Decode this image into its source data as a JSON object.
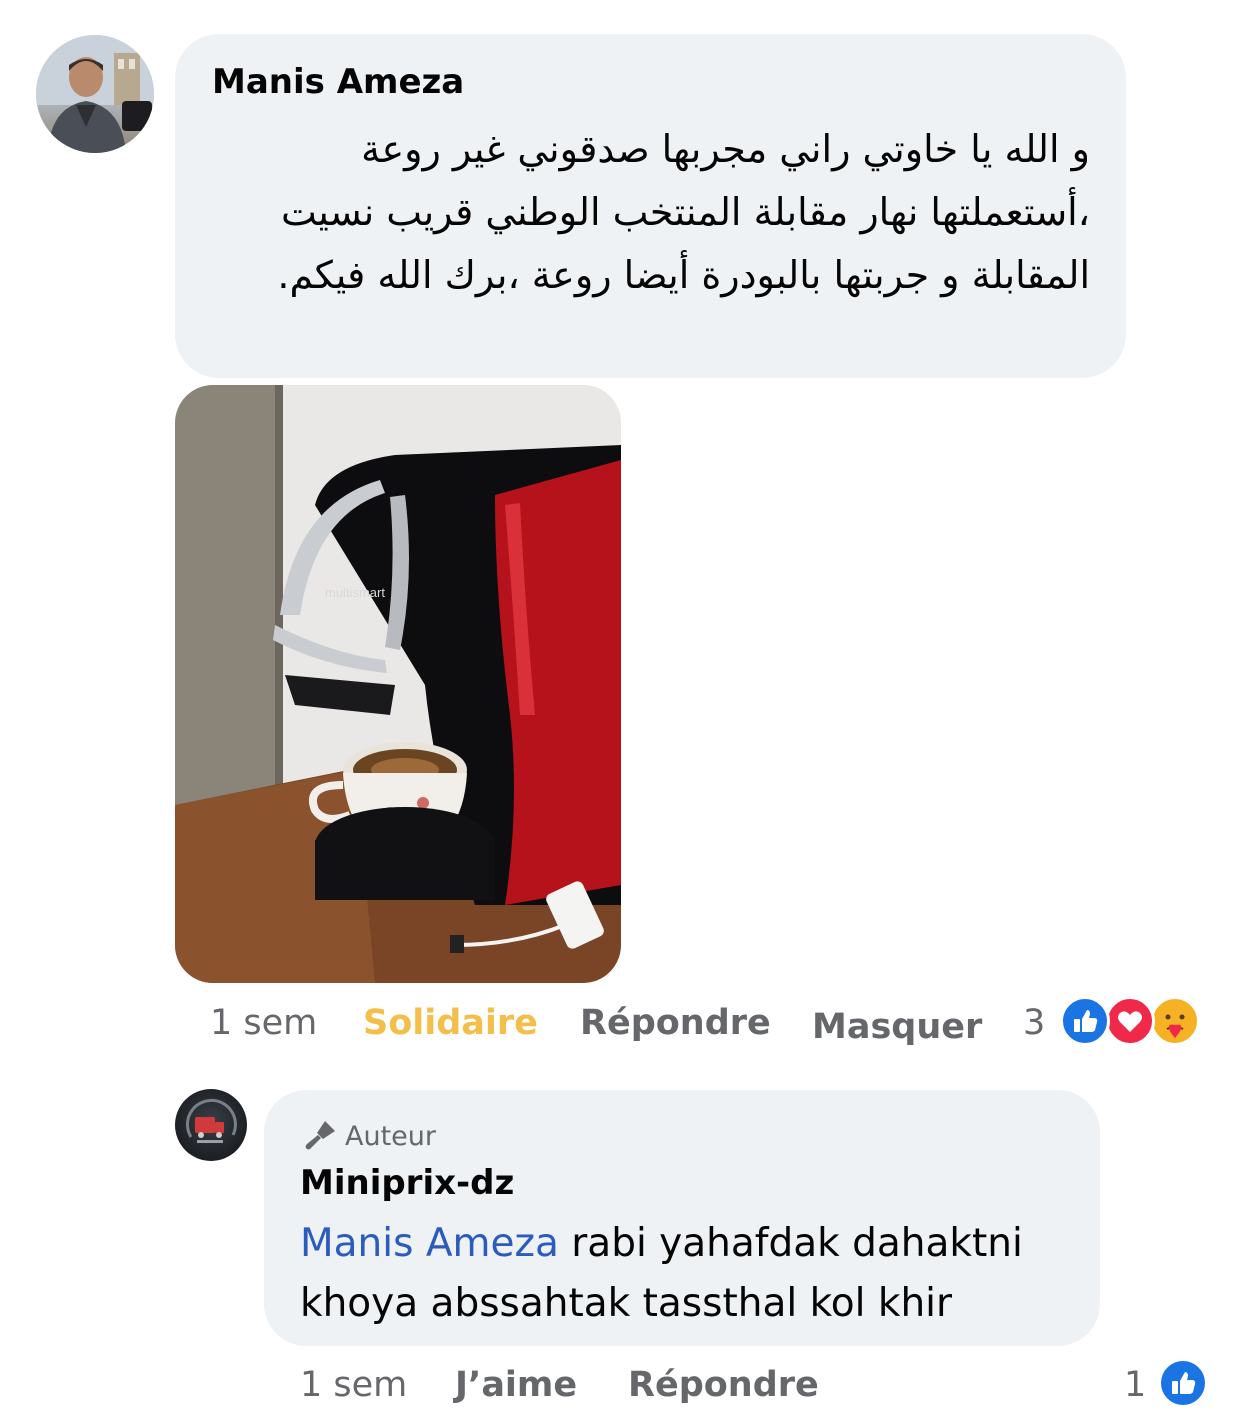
{
  "comment": {
    "author": "Manis Ameza",
    "text": "و الله يا خاوتي راني مجربها صدقوني غير روعة ،أستعملتها نهار مقابلة المنتخب الوطني قريب نسيت المقابلة و جربتها بالبودرة أيضا روعة ،برك الله فيكم.",
    "photo_brand_text": "multismart",
    "time": "1 sem",
    "actions": {
      "solidaire": "Solidaire",
      "reply": "Répondre",
      "hide": "Masquer"
    },
    "reaction_count": "3",
    "reaction_icons": [
      "like-icon",
      "love-icon",
      "care-icon"
    ]
  },
  "reply": {
    "badge": "Auteur",
    "author": "Miniprix-dz",
    "mention": "Manis Ameza",
    "text": " rabi yahafdak  dahaktni khoya abssahtak tassthal kol khir",
    "time": "1 sem",
    "actions": {
      "like": "J’aime",
      "reply": "Répondre"
    },
    "reaction_count": "1",
    "reaction_icons": [
      "like-icon"
    ]
  },
  "colors": {
    "bubble": "#eff2f5",
    "solidaire": "#f4be4a",
    "secondary_text": "#65676b",
    "mention": "#2b5bbd",
    "like": "#1b74e4",
    "love": "#f02849",
    "care": "#f7b125"
  }
}
